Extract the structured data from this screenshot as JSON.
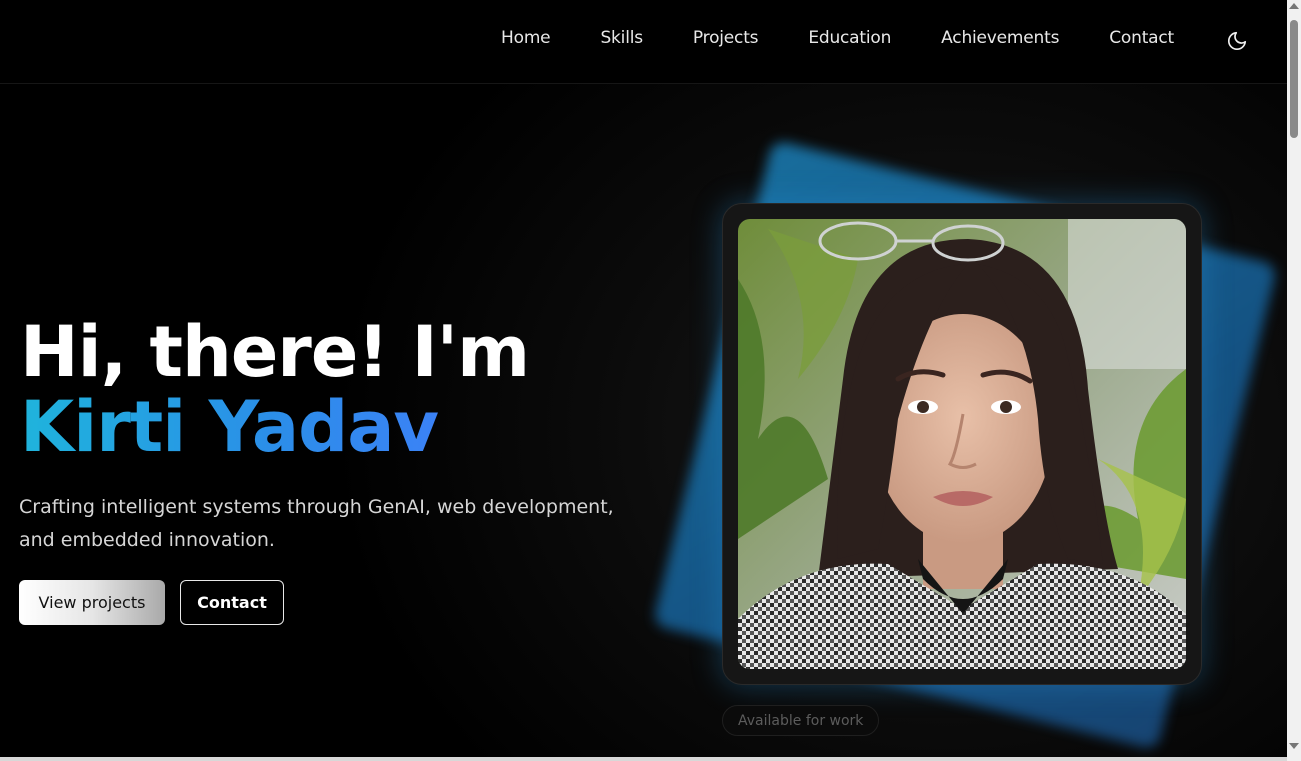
{
  "nav": {
    "links": [
      "Home",
      "Skills",
      "Projects",
      "Education",
      "Achievements",
      "Contact"
    ],
    "theme_toggle_icon": "moon-icon"
  },
  "hero": {
    "greeting": "Hi, there! I'm",
    "name": "Kirti Yadav",
    "description": "Crafting intelligent systems through GenAI, web development, and embedded innovation.",
    "primary_button": "View projects",
    "secondary_button": "Contact",
    "status": "Available for work"
  },
  "colors": {
    "name_gradient_start": "#1fb4dc",
    "name_gradient_end": "#3b82f6",
    "accent_glow": "#1b7fb7"
  }
}
